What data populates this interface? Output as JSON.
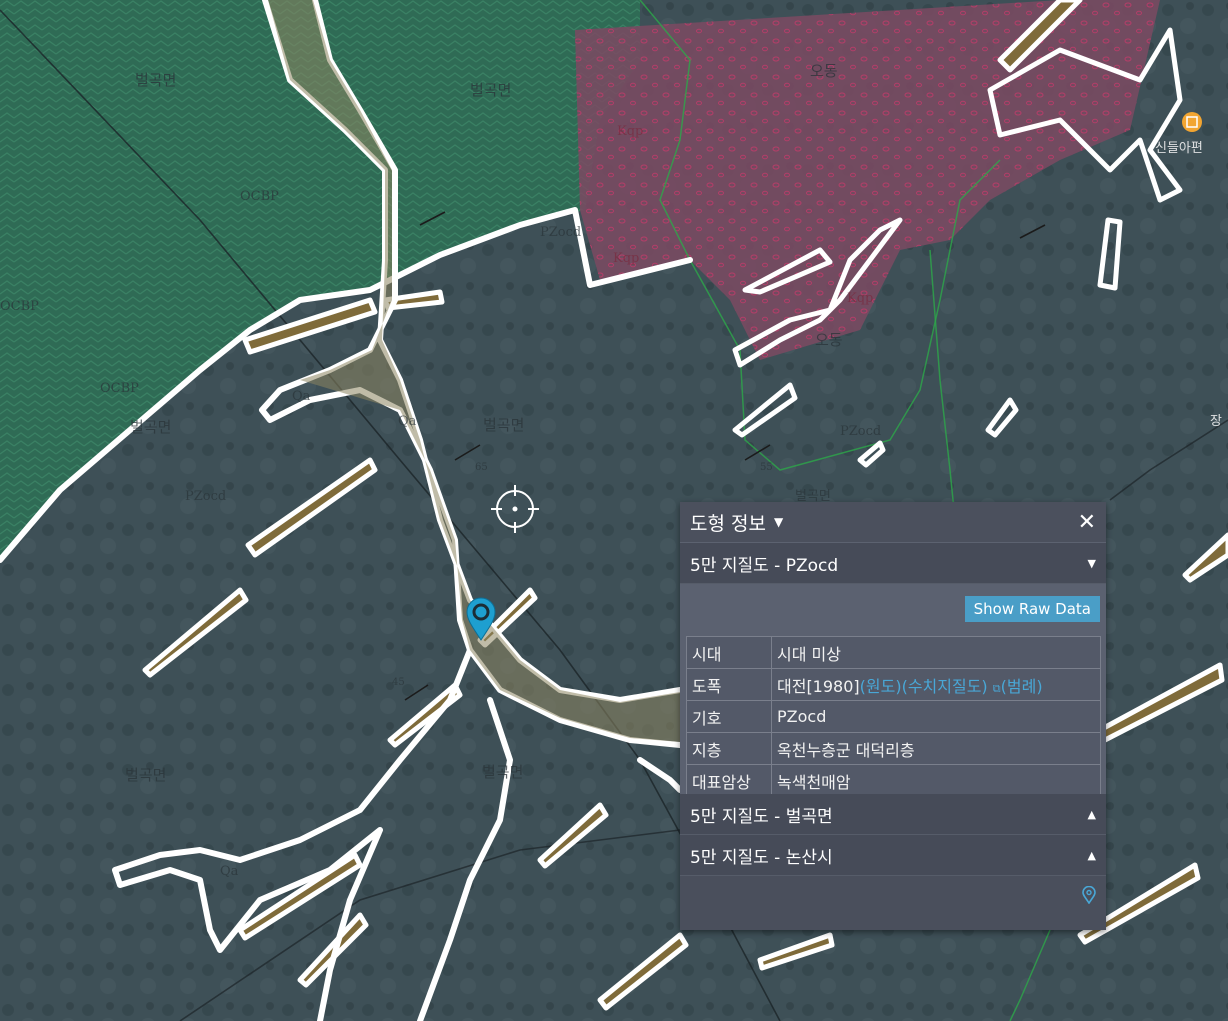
{
  "map": {
    "labels": {
      "byeolgok_1": "벌곡면",
      "byeolgok_2": "벌곡면",
      "byeolgok_3": "벌곡면",
      "byeolgok_4": "벌곡면",
      "byeolgok_5": "벌곡면",
      "byeolgok_6": "벌곡면",
      "byeolgok_7": "벌곡면",
      "odong_1": "오동",
      "odong_2": "오동",
      "sindeung": "신들아편",
      "ocbp_1": "OCBP",
      "ocbp_2": "OCBP",
      "ocbp_3": "OCBP",
      "pzocd_1": "PZocd",
      "pzocd_2": "PZocd",
      "pzocd_3": "PZocd",
      "kqp_1": "Kqp",
      "kqp_2": "Kqp",
      "kqp_3": "Kqp",
      "qa_1": "Qa",
      "qa_2": "Qa",
      "qa_3": "Qa",
      "edge_jang": "장",
      "dip_1": "65",
      "dip_2": "45",
      "dip_3": "55"
    },
    "poi_icon": "restaurant-icon"
  },
  "panel": {
    "title": "도형 정보",
    "close_icon": "close-icon",
    "sections": [
      {
        "label": "5만 지질도 - PZocd",
        "state": "expanded"
      },
      {
        "label": "5만 지질도 - 벌곡면",
        "state": "collapsed"
      },
      {
        "label": "5만 지질도 - 논산시",
        "state": "collapsed"
      }
    ],
    "raw_button": "Show Raw Data",
    "rows": [
      {
        "key": "시대",
        "value": "시대 미상"
      },
      {
        "key": "도폭",
        "value": "대전[1980]",
        "links": [
          "(원도)",
          "(수치지질도)",
          "(범례)"
        ]
      },
      {
        "key": "기호",
        "value": "PZocd"
      },
      {
        "key": "지층",
        "value": "옥천누층군 대덕리층"
      },
      {
        "key": "대표암상",
        "value": "녹색천매암"
      }
    ]
  },
  "colors": {
    "accent": "#4a9ec7",
    "panel_bg": "#4a4f5c",
    "pin": "#1e9fd0",
    "green_unit": "#2f6b55",
    "pink_unit": "#7a4a62",
    "brown_band": "#7f6b3a"
  }
}
